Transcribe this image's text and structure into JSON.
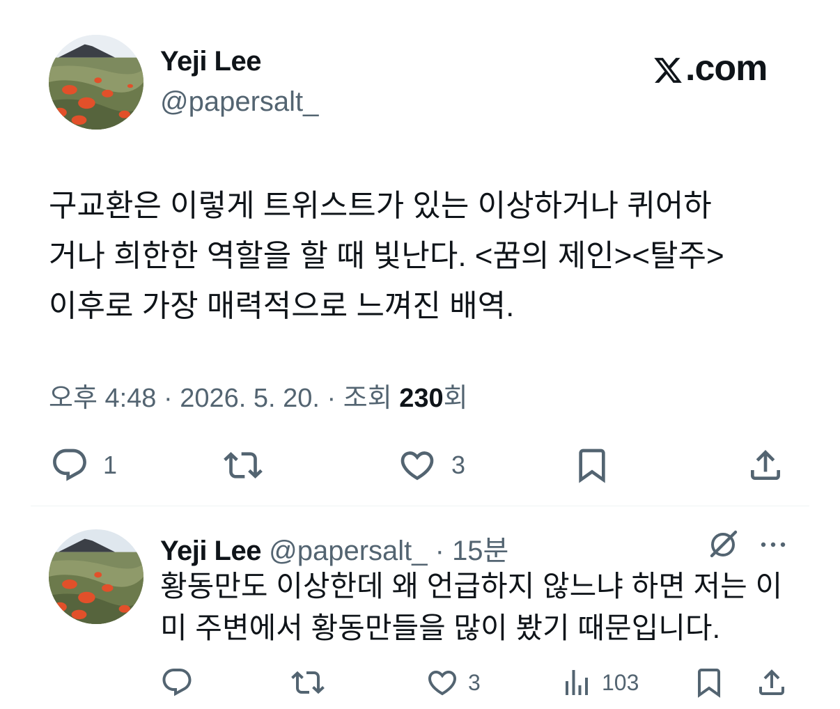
{
  "brand": {
    "domain_suffix": ".com",
    "logo_icon": "x-logo-icon"
  },
  "main_tweet": {
    "author_name": "Yeji Lee",
    "handle": "@papersalt_",
    "text_lines": [
      "구교환은 이렇게 트위스트가 있는 이상하거나 퀴어하",
      "거나 희한한 역할을 할 때 빛난다. <꿈의 제인><탈주>",
      "이후로 가장 매력적으로 느껴진 배역."
    ],
    "meta": {
      "time": "오후 4:48",
      "sep1": " · ",
      "date": "2026. 5. 20.",
      "sep2": " · ",
      "views_label": "조회 ",
      "views_count": "230",
      "views_suffix": "회"
    },
    "actions": {
      "reply_count": "1",
      "like_count": "3"
    }
  },
  "reply_tweet": {
    "author_name": "Yeji Lee",
    "handle": "@papersalt_",
    "dot": " · ",
    "time": "15분",
    "text_lines": [
      "황동만도 이상한데 왜 언급하지 않느냐 하면 저는 이",
      "미 주변에서 황동만들을 많이 봤기 때문입니다."
    ],
    "actions": {
      "like_count": "3",
      "views_count": "103"
    }
  },
  "colors": {
    "text": "#0f1419",
    "secondary": "#536471",
    "divider": "#eff3f4"
  }
}
